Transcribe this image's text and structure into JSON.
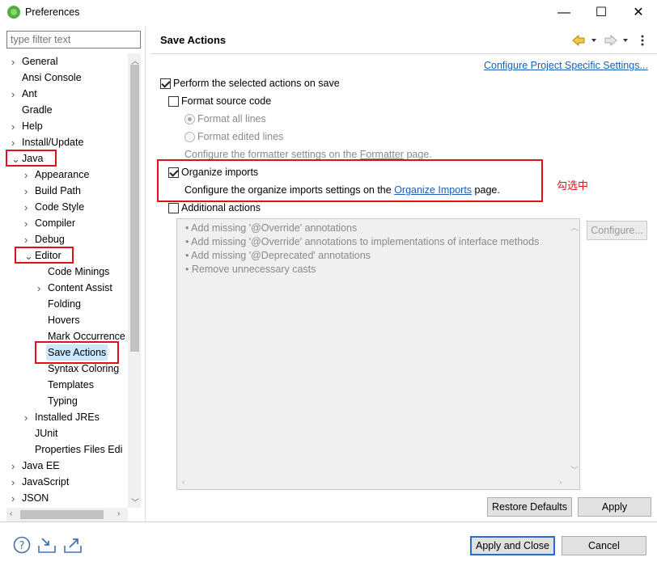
{
  "window": {
    "title": "Preferences",
    "controls": {
      "minimize": "—",
      "maximize": "☐",
      "close": "✕"
    }
  },
  "filter": {
    "placeholder": "type filter text"
  },
  "tree": [
    {
      "label": "General",
      "twisty": "›",
      "level": 0
    },
    {
      "label": "Ansi Console",
      "twisty": "",
      "level": 0
    },
    {
      "label": "Ant",
      "twisty": "›",
      "level": 0
    },
    {
      "label": "Gradle",
      "twisty": "",
      "level": 0
    },
    {
      "label": "Help",
      "twisty": "›",
      "level": 0
    },
    {
      "label": "Install/Update",
      "twisty": "›",
      "level": 0
    },
    {
      "label": "Java",
      "twisty": "⌄",
      "level": 0
    },
    {
      "label": "Appearance",
      "twisty": "›",
      "level": 1
    },
    {
      "label": "Build Path",
      "twisty": "›",
      "level": 1
    },
    {
      "label": "Code Style",
      "twisty": "›",
      "level": 1
    },
    {
      "label": "Compiler",
      "twisty": "›",
      "level": 1
    },
    {
      "label": "Debug",
      "twisty": "›",
      "level": 1
    },
    {
      "label": "Editor",
      "twisty": "⌄",
      "level": 1
    },
    {
      "label": "Code Minings",
      "twisty": "",
      "level": 2
    },
    {
      "label": "Content Assist",
      "twisty": "›",
      "level": 2
    },
    {
      "label": "Folding",
      "twisty": "",
      "level": 2
    },
    {
      "label": "Hovers",
      "twisty": "",
      "level": 2
    },
    {
      "label": "Mark Occurrence",
      "twisty": "",
      "level": 2
    },
    {
      "label": "Save Actions",
      "twisty": "",
      "level": 2,
      "selected": true
    },
    {
      "label": "Syntax Coloring",
      "twisty": "",
      "level": 2
    },
    {
      "label": "Templates",
      "twisty": "",
      "level": 2
    },
    {
      "label": "Typing",
      "twisty": "",
      "level": 2
    },
    {
      "label": "Installed JREs",
      "twisty": "›",
      "level": 1
    },
    {
      "label": "JUnit",
      "twisty": "",
      "level": 1
    },
    {
      "label": "Properties Files Edi",
      "twisty": "",
      "level": 1
    },
    {
      "label": "Java EE",
      "twisty": "›",
      "level": 0
    },
    {
      "label": "JavaScript",
      "twisty": "›",
      "level": 0
    },
    {
      "label": "JSON",
      "twisty": "›",
      "level": 0
    }
  ],
  "page": {
    "title": "Save Actions",
    "project_link": "Configure Project Specific Settings...",
    "perform_label": "Perform the selected actions on save",
    "perform_checked": true,
    "format_label": "Format source code",
    "format_checked": false,
    "format_all": "Format all lines",
    "format_edited": "Format edited lines",
    "formatter_note_pre": "Configure the formatter settings on the ",
    "formatter_note_link": "Formatter",
    "formatter_note_post": " page.",
    "organize_label": "Organize imports",
    "organize_checked": true,
    "organize_note_pre": "Configure the organize imports settings on the ",
    "organize_note_link": "Organize Imports",
    "organize_note_post": " page.",
    "annotation": "勾选中",
    "additional_label": "Additional actions",
    "additional_checked": false,
    "actions": [
      "• Add missing '@Override' annotations",
      "• Add missing '@Override' annotations to implementations of interface methods",
      "• Add missing '@Deprecated' annotations",
      "• Remove unnecessary casts"
    ],
    "configure_btn": "Configure...",
    "restore_btn": "Restore Defaults",
    "apply_btn": "Apply"
  },
  "footer": {
    "apply_close_btn": "Apply and Close",
    "cancel_btn": "Cancel",
    "icons": [
      "help-icon",
      "import-icon",
      "export-icon"
    ]
  },
  "colors": {
    "highlight_box": "#e3101c",
    "link": "#1a5fb4",
    "selection": "#cce8ff"
  }
}
